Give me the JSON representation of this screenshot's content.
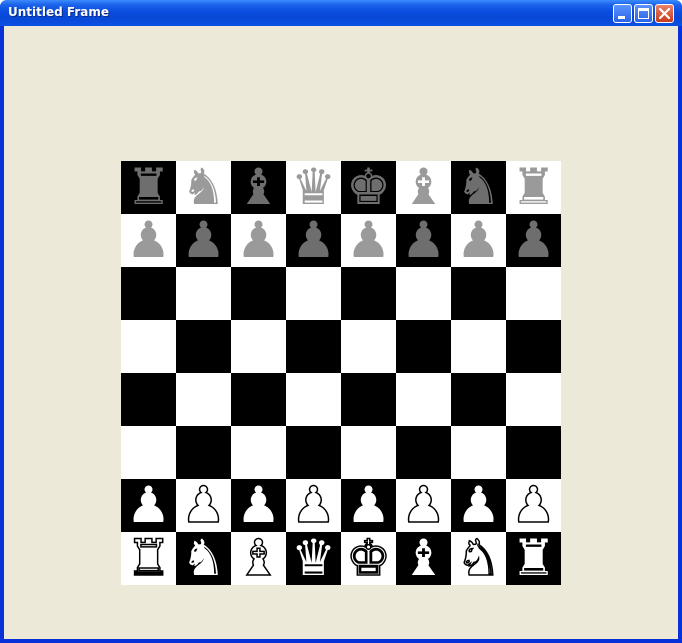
{
  "window": {
    "title": "Untitled Frame",
    "buttons": [
      {
        "name": "minimize",
        "icon": "minimize-icon"
      },
      {
        "name": "maximize",
        "icon": "maximize-icon"
      },
      {
        "name": "close",
        "icon": "close-icon"
      }
    ]
  },
  "board": {
    "size": 8,
    "top_left_color": "black",
    "rows": [
      [
        "br",
        "bn",
        "bb",
        "bq",
        "bk",
        "bb",
        "bn",
        "br"
      ],
      [
        "bp",
        "bp",
        "bp",
        "bp",
        "bp",
        "bp",
        "bp",
        "bp"
      ],
      [
        "",
        "",
        "",
        "",
        "",
        "",
        "",
        ""
      ],
      [
        "",
        "",
        "",
        "",
        "",
        "",
        "",
        ""
      ],
      [
        "",
        "",
        "",
        "",
        "",
        "",
        "",
        ""
      ],
      [
        "",
        "",
        "",
        "",
        "",
        "",
        "",
        ""
      ],
      [
        "wp",
        "wp",
        "wp",
        "wp",
        "wp",
        "wp",
        "wp",
        "wp"
      ],
      [
        "wr",
        "wn",
        "wb",
        "wq",
        "wk",
        "wb",
        "wn",
        "wr"
      ]
    ],
    "colors": {
      "dark_square": "#000000",
      "light_square": "#ffffff",
      "black_piece": "#6e6e6e",
      "frame_bg": "#ece9d8"
    }
  }
}
